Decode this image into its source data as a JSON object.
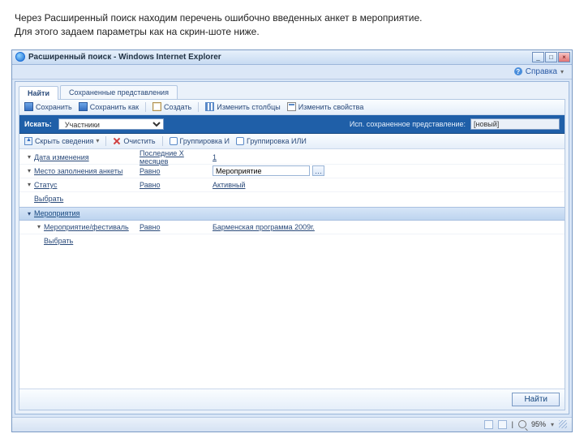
{
  "instructions": {
    "line1": "Через Расширенный поиск находим перечень ошибочно введенных анкет в мероприятие.",
    "line2": "Для этого задаем параметры как на скрин-шоте ниже."
  },
  "titlebar": {
    "title": "Расширенный поиск - Windows Internet Explorer"
  },
  "win": {
    "min": "_",
    "max": "□",
    "close": "×"
  },
  "help": {
    "label": "Справка",
    "q": "?"
  },
  "tabs": {
    "find": "Найти",
    "saved": "Сохраненные представления"
  },
  "toolbar1": {
    "save": "Сохранить",
    "saveAs": "Сохранить как",
    "create": "Создать",
    "editCols": "Изменить столбцы",
    "editProps": "Изменить свойства"
  },
  "searchrow": {
    "label": "Искать:",
    "entity": "Участники",
    "savedLabel": "Исп. сохраненное представление:",
    "savedValue": "[новый]"
  },
  "toolbar2": {
    "hide": "Скрыть сведения",
    "clear": "Очистить",
    "groupAnd": "Группировка И",
    "groupOr": "Группировка ИЛИ"
  },
  "criteria": {
    "rows": [
      {
        "field": "Дата изменения",
        "op": "Последние X месяцев",
        "val": "1",
        "valLink": true
      },
      {
        "field": "Место заполнения анкеты",
        "op": "Равно",
        "val": "Мероприятие",
        "lookup": true
      },
      {
        "field": "Статус",
        "op": "Равно",
        "val": "Активный",
        "valLink": true
      }
    ],
    "select": "Выбрать"
  },
  "group": {
    "title": "Мероприятия",
    "row": {
      "field": "Мероприятие/фестиваль",
      "op": "Равно",
      "val": "Барменская программа 2009г."
    },
    "select": "Выбрать"
  },
  "footer": {
    "find": "Найти"
  },
  "statusbar": {
    "zoom": "95%"
  }
}
